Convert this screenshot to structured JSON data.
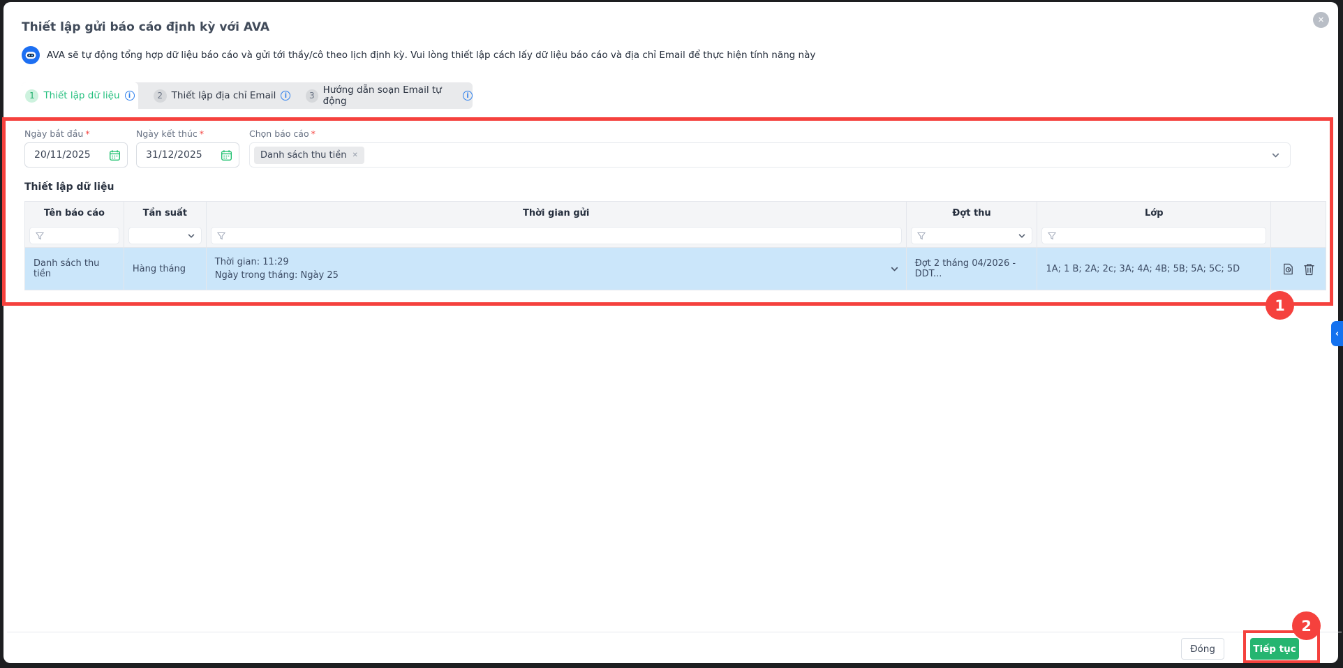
{
  "modal": {
    "title": "Thiết lập gửi báo cáo định kỳ với AVA",
    "description": "AVA sẽ tự động tổng hợp dữ liệu báo cáo và gửi tới thầy/cô theo lịch định kỳ. Vui lòng thiết lập cách lấy dữ liệu báo cáo và địa chỉ Email để thực hiện tính năng này"
  },
  "icons": {
    "close_glyph": "✕",
    "info_glyph": "i",
    "tag_remove_glyph": "✕",
    "collapse_glyph": "‹"
  },
  "tabs": [
    {
      "number": "1",
      "label": "Thiết lập dữ liệu"
    },
    {
      "number": "2",
      "label": "Thiết lập địa chỉ Email"
    },
    {
      "number": "3",
      "label": "Hướng dẫn soạn Email tự động"
    }
  ],
  "form": {
    "start_date": {
      "label": "Ngày bắt đầu",
      "required_mark": "*",
      "value": "20/11/2025"
    },
    "end_date": {
      "label": "Ngày kết thúc",
      "required_mark": "*",
      "value": "31/12/2025"
    },
    "report_select": {
      "label": "Chọn báo cáo",
      "required_mark": "*",
      "selected_tag": "Danh sách thu tiền"
    }
  },
  "table": {
    "section_title": "Thiết lập dữ liệu",
    "columns": [
      "Tên báo cáo",
      "Tần suất",
      "Thời gian gửi",
      "Đợt thu",
      "Lớp"
    ],
    "row": {
      "report_name": "Danh sách thu tiền",
      "frequency": "Hàng tháng",
      "send_time": "Thời gian: 11:29",
      "send_day": "Ngày trong tháng: Ngày 25",
      "collection_batch": "Đợt 2 tháng 04/2026 - DDT...",
      "classes": "1A; 1 B; 2A; 2c; 3A; 4A; 4B; 5B; 5A; 5C; 5D"
    }
  },
  "footer": {
    "close_label": "Đóng",
    "continue_label": "Tiếp tục"
  },
  "annotations": {
    "step1": "1",
    "step2": "2"
  },
  "colors": {
    "accent_green": "#25b570",
    "accent_blue": "#2f80ed",
    "annotation_red": "#f5413d",
    "row_highlight": "#cbe6fa"
  }
}
